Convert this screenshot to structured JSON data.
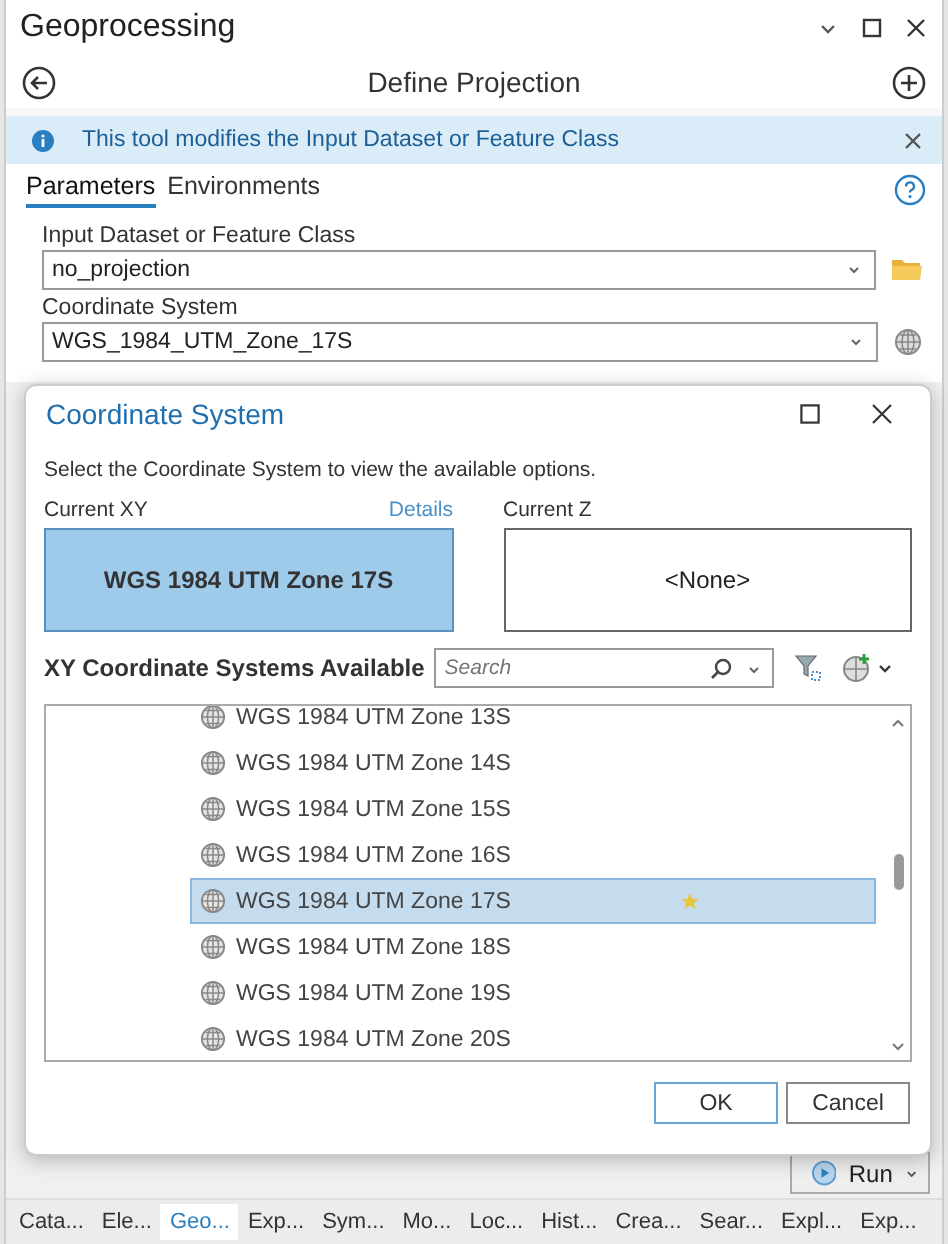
{
  "panel": {
    "title": "Geoprocessing",
    "tool_title": "Define Projection",
    "info_message": "This tool modifies the Input Dataset or Feature Class",
    "tabs": [
      {
        "label": "Parameters",
        "selected": true
      },
      {
        "label": "Environments",
        "selected": false
      }
    ],
    "parameters": [
      {
        "label": "Input Dataset or Feature Class",
        "value": "no_projection",
        "kind": "dataset"
      },
      {
        "label": "Coordinate System",
        "value": "WGS_1984_UTM_Zone_17S",
        "kind": "coordsys"
      }
    ],
    "run_button": "Run"
  },
  "dialog": {
    "title": "Coordinate System",
    "instruction": "Select the Coordinate System to view the available options.",
    "current_xy": {
      "label": "Current XY",
      "link": "Details",
      "value": "WGS 1984 UTM Zone 17S"
    },
    "current_z": {
      "label": "Current Z",
      "value": "<None>"
    },
    "available_label": "XY Coordinate Systems Available",
    "search": {
      "placeholder": "Search"
    },
    "items": [
      {
        "name": "WGS 1984 UTM Zone 13S",
        "selected": false,
        "favorite": false
      },
      {
        "name": "WGS 1984 UTM Zone 14S",
        "selected": false,
        "favorite": false
      },
      {
        "name": "WGS 1984 UTM Zone 15S",
        "selected": false,
        "favorite": false
      },
      {
        "name": "WGS 1984 UTM Zone 16S",
        "selected": false,
        "favorite": false
      },
      {
        "name": "WGS 1984 UTM Zone 17S",
        "selected": true,
        "favorite": true
      },
      {
        "name": "WGS 1984 UTM Zone 18S",
        "selected": false,
        "favorite": false
      },
      {
        "name": "WGS 1984 UTM Zone 19S",
        "selected": false,
        "favorite": false
      },
      {
        "name": "WGS 1984 UTM Zone 20S",
        "selected": false,
        "favorite": false
      }
    ],
    "buttons": [
      "OK",
      "Cancel"
    ]
  },
  "bottom_tabs": [
    {
      "label": "Cata...",
      "selected": false
    },
    {
      "label": "Ele...",
      "selected": false
    },
    {
      "label": "Geo...",
      "selected": true
    },
    {
      "label": "Exp...",
      "selected": false
    },
    {
      "label": "Sym...",
      "selected": false
    },
    {
      "label": "Mo...",
      "selected": false
    },
    {
      "label": "Loc...",
      "selected": false
    },
    {
      "label": "Hist...",
      "selected": false
    },
    {
      "label": "Crea...",
      "selected": false
    },
    {
      "label": "Sear...",
      "selected": false
    },
    {
      "label": "Expl...",
      "selected": false
    },
    {
      "label": "Exp...",
      "selected": false
    }
  ]
}
